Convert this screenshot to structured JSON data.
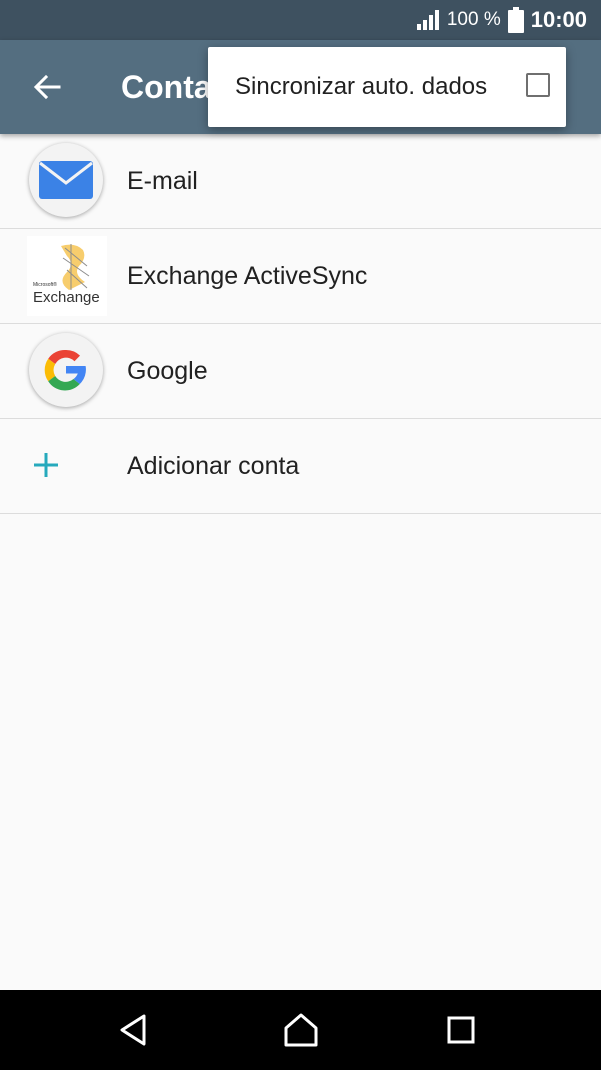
{
  "status_bar": {
    "battery_percent": "100 %",
    "time": "10:00"
  },
  "app_bar": {
    "title": "Conta"
  },
  "overflow_menu": {
    "auto_sync_label": "Sincronizar auto. dados",
    "auto_sync_checked": false
  },
  "accounts": {
    "items": [
      {
        "label": "E-mail",
        "icon": "email-icon"
      },
      {
        "label": "Exchange ActiveSync",
        "icon": "exchange-icon"
      },
      {
        "label": "Google",
        "icon": "google-icon"
      }
    ],
    "add_label": "Adicionar conta"
  },
  "exchange_logo": {
    "small_text": "Microsoft®",
    "big_text": "Exchange"
  },
  "colors": {
    "status_bar": "#3e5160",
    "app_bar": "#546e80",
    "accent": "#26a9bc"
  }
}
